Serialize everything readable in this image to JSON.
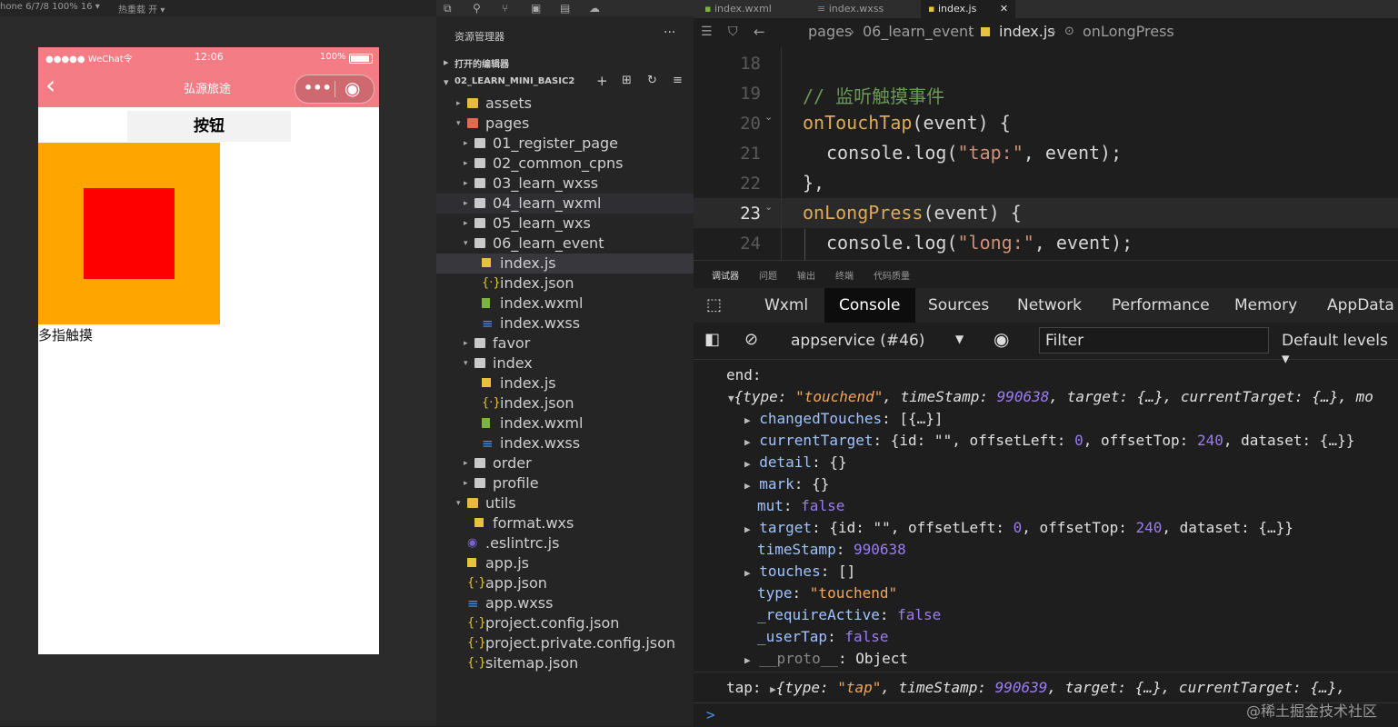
{
  "simulator": {
    "top_label": "hone 6/7/8 100% 16 ▾",
    "top_label2": "热重载 开 ▾",
    "status_dots": "●●●●● WeChat令",
    "status_time": "12:06",
    "status_battery": "100%",
    "nav_title": "弘源旅途",
    "capsule_more": "•••",
    "capsule_close": "◉",
    "back": "‹",
    "button_label": "按钮",
    "multitouch_label": "多指触摸"
  },
  "explorer": {
    "title": "资源管理器",
    "more": "···",
    "open_editors": "打开的编辑器",
    "project": "02_LEARN_MINI_BASIC2",
    "items": [
      {
        "label": "assets",
        "depth": 0,
        "kind": "folder-y",
        "arrow": "▸"
      },
      {
        "label": "pages",
        "depth": 0,
        "kind": "folder-r",
        "arrow": "▾"
      },
      {
        "label": "01_register_page",
        "depth": 1,
        "kind": "folder",
        "arrow": "▸"
      },
      {
        "label": "02_common_cpns",
        "depth": 1,
        "kind": "folder",
        "arrow": "▸"
      },
      {
        "label": "03_learn_wxss",
        "depth": 1,
        "kind": "folder",
        "arrow": "▸"
      },
      {
        "label": "04_learn_wxml",
        "depth": 1,
        "kind": "folder",
        "arrow": "▸"
      },
      {
        "label": "05_learn_wxs",
        "depth": 1,
        "kind": "folder",
        "arrow": "▸"
      },
      {
        "label": "06_learn_event",
        "depth": 1,
        "kind": "folder",
        "arrow": "▾"
      },
      {
        "label": "index.js",
        "depth": 2,
        "kind": "js",
        "arrow": ""
      },
      {
        "label": "index.json",
        "depth": 2,
        "kind": "json",
        "arrow": ""
      },
      {
        "label": "index.wxml",
        "depth": 2,
        "kind": "wxml",
        "arrow": ""
      },
      {
        "label": "index.wxss",
        "depth": 2,
        "kind": "wxss",
        "arrow": ""
      },
      {
        "label": "favor",
        "depth": 1,
        "kind": "folder",
        "arrow": "▸"
      },
      {
        "label": "index",
        "depth": 1,
        "kind": "folder",
        "arrow": "▾"
      },
      {
        "label": "index.js",
        "depth": 2,
        "kind": "js",
        "arrow": ""
      },
      {
        "label": "index.json",
        "depth": 2,
        "kind": "json",
        "arrow": ""
      },
      {
        "label": "index.wxml",
        "depth": 2,
        "kind": "wxml",
        "arrow": ""
      },
      {
        "label": "index.wxss",
        "depth": 2,
        "kind": "wxss",
        "arrow": ""
      },
      {
        "label": "order",
        "depth": 1,
        "kind": "folder",
        "arrow": "▸"
      },
      {
        "label": "profile",
        "depth": 1,
        "kind": "folder",
        "arrow": "▸"
      },
      {
        "label": "utils",
        "depth": 0,
        "kind": "folder-y",
        "arrow": "▾"
      },
      {
        "label": "format.wxs",
        "depth": 1,
        "kind": "js",
        "arrow": ""
      },
      {
        "label": ".eslintrc.js",
        "depth": 0,
        "kind": "eslint",
        "arrow": ""
      },
      {
        "label": "app.js",
        "depth": 0,
        "kind": "js",
        "arrow": ""
      },
      {
        "label": "app.json",
        "depth": 0,
        "kind": "json",
        "arrow": ""
      },
      {
        "label": "app.wxss",
        "depth": 0,
        "kind": "wxss",
        "arrow": ""
      },
      {
        "label": "project.config.json",
        "depth": 0,
        "kind": "json",
        "arrow": ""
      },
      {
        "label": "project.private.config.json",
        "depth": 0,
        "kind": "json",
        "arrow": ""
      },
      {
        "label": "sitemap.json",
        "depth": 0,
        "kind": "json",
        "arrow": ""
      }
    ]
  },
  "editor": {
    "tabs": [
      "index.wxml",
      "index.wxss",
      "index.js"
    ],
    "tab_close": "✕",
    "breadcrumb": [
      "pages",
      "06_learn_event",
      "index.js",
      "onLongPress"
    ],
    "lines": [
      "18",
      "19",
      "20",
      "21",
      "22",
      "23",
      "24"
    ],
    "code": {
      "comment": "// 监听触摸事件",
      "l20_fn": "onTouchTap",
      "l20_rest": "(event) {",
      "l21_a": "console.log(",
      "l21_str": "\"tap:\"",
      "l21_b": ", event);",
      "l22": "},",
      "l23_fn": "onLongPress",
      "l23_rest": "(event) {",
      "l24_a": "console.log(",
      "l24_str": "\"long:\"",
      "l24_b": ", event);"
    }
  },
  "devtools": {
    "small_tabs": [
      "调试器",
      "问题",
      "输出",
      "终端",
      "代码质量"
    ],
    "tabs": [
      "Wxml",
      "Console",
      "Sources",
      "Network",
      "Performance",
      "Memory",
      "AppData"
    ],
    "context": "appservice (#46)",
    "filter_placeholder": "Filter",
    "levels": "Default levels ▾",
    "console": {
      "end_label": "end:",
      "summary_type": "\"touchend\"",
      "summary_ts": "990638",
      "summary_rest": "target: {…}, currentTarget: {…}, mo",
      "changedTouches": "[{…}]",
      "currentTarget_offsetTop": "240",
      "currentTarget_offsetLeft": "0",
      "mut": "false",
      "target_offsetTop": "240",
      "target_offsetLeft": "0",
      "timeStamp": "990638",
      "type": "\"touchend\"",
      "requireActive": "false",
      "userTap": "false",
      "proto": "Object",
      "tap_label": "tap:",
      "tap_type": "\"tap\"",
      "tap_ts": "990639",
      "tap_rest": "target: {…}, currentTarget: {…},",
      "prompt": ">",
      "watermark": "@稀土掘金技术社区"
    }
  }
}
